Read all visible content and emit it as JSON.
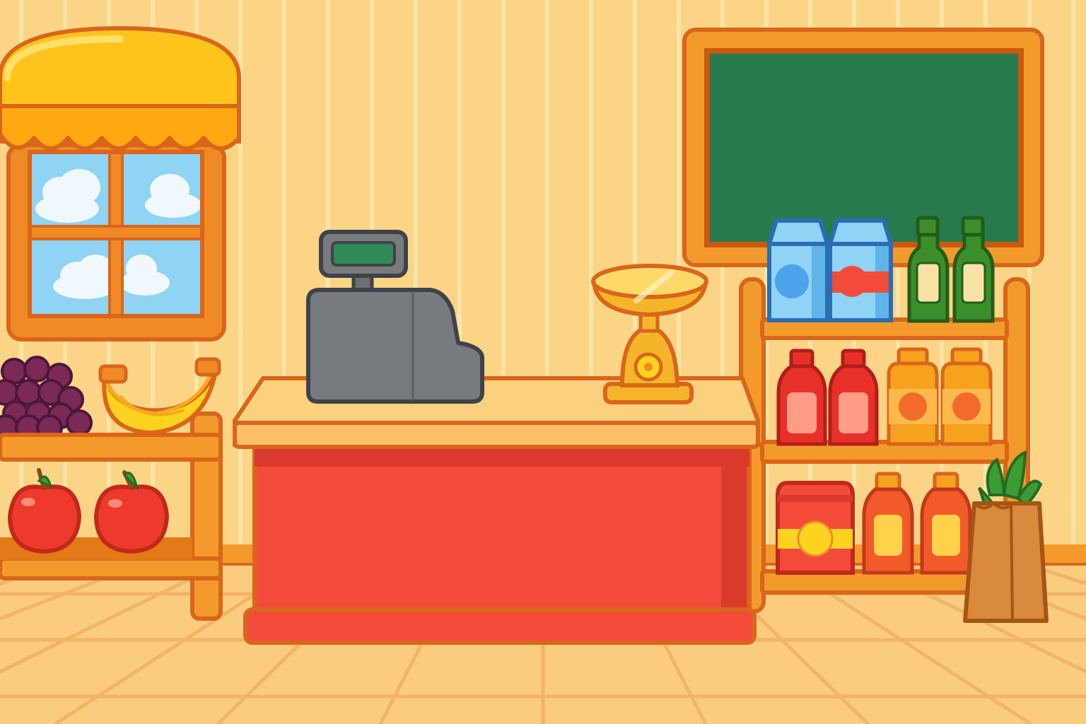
{
  "scene": {
    "type": "grocery-store-interior",
    "colors": {
      "wall": "#fbd486",
      "wall_stripe": "#fde3a6",
      "floor": "#fbcb7e",
      "floor_line": "#f4b35e",
      "outline": "#d9661a",
      "wood": "#f39a2c",
      "counter_front": "#f24b3a",
      "counter_top": "#fdd07e",
      "chalkboard": "#277a4e",
      "register": "#777a7e",
      "register_screen": "#2f8a57",
      "awning": "#ffc41c",
      "sky": "#8fd3f5"
    },
    "objects": [
      {
        "name": "window",
        "icon": "window-icon"
      },
      {
        "name": "awning",
        "icon": "awning-icon"
      },
      {
        "name": "fruit-stand",
        "icon": "shelf-icon"
      },
      {
        "name": "grapes",
        "icon": "grapes-icon"
      },
      {
        "name": "bananas",
        "icon": "banana-icon"
      },
      {
        "name": "apple",
        "icon": "apple-icon"
      },
      {
        "name": "checkout-counter",
        "icon": "counter-icon"
      },
      {
        "name": "cash-register",
        "icon": "cash-register-icon"
      },
      {
        "name": "weighing-scale",
        "icon": "scale-icon"
      },
      {
        "name": "chalkboard",
        "icon": "chalkboard-icon"
      },
      {
        "name": "milk-carton",
        "icon": "milk-icon"
      },
      {
        "name": "oil-bottle",
        "icon": "bottle-icon"
      },
      {
        "name": "sauce-bottle",
        "icon": "bottle-icon"
      },
      {
        "name": "juice-box",
        "icon": "juice-icon"
      },
      {
        "name": "paper-bag",
        "icon": "grocery-bag-icon"
      }
    ]
  }
}
